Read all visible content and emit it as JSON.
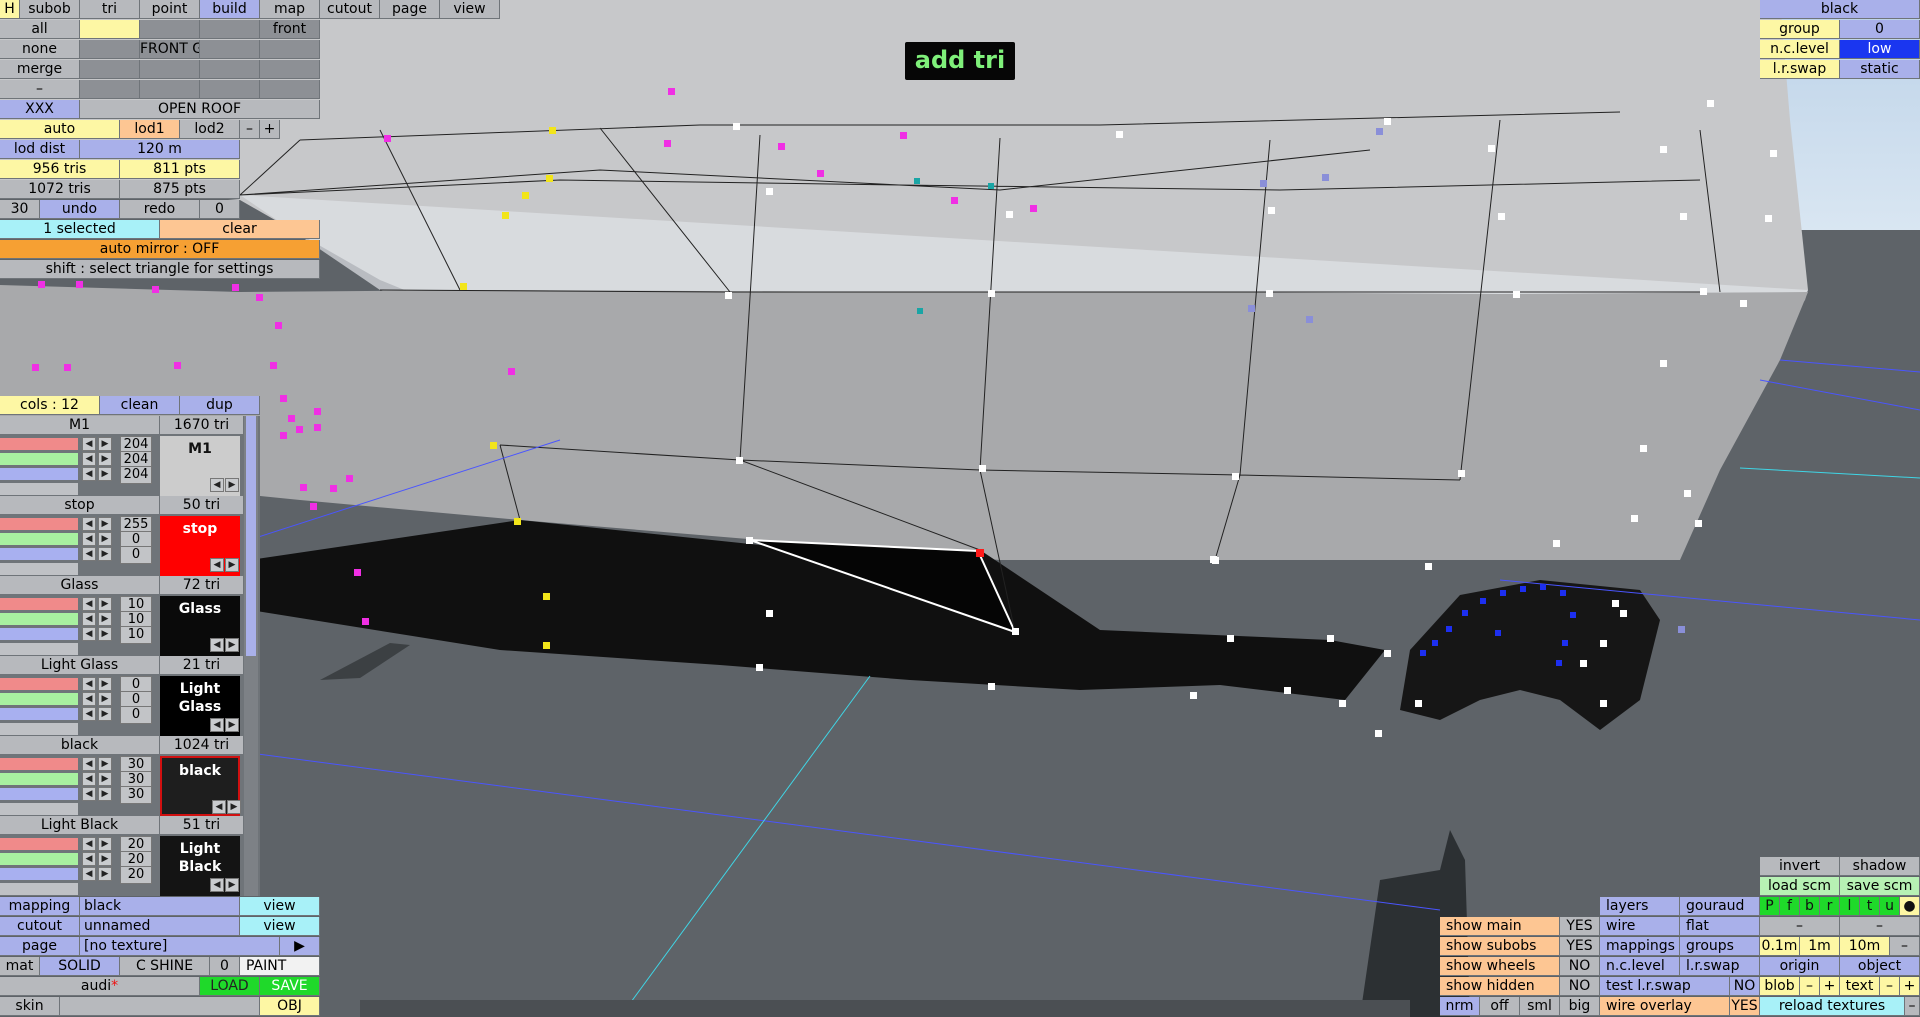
{
  "toast": "add tri",
  "top_tabs": {
    "h": "H",
    "subob": "subob",
    "tri": "tri",
    "point": "point",
    "build": "build",
    "map": "map",
    "cutout": "cutout",
    "page": "page",
    "view": "view"
  },
  "left_panel": {
    "all": "all",
    "front": "front",
    "none": "none",
    "front_g": "FRONT G",
    "merge": "merge",
    "dash": "–",
    "xxx": "XXX",
    "open_roof": "OPEN ROOF",
    "auto": "auto",
    "lod1": "lod1",
    "lod2": "lod2",
    "minus": "–",
    "plus": "+",
    "lod_dist_label": "lod dist",
    "lod_dist_value": "120 m",
    "tris1": "956 tris",
    "pts1": "811 pts",
    "tris2": "1072 tris",
    "pts2": "875 pts",
    "undo_count": "30",
    "undo": "undo",
    "redo": "redo",
    "redo_count": "0",
    "selected": "1 selected",
    "clear": "clear",
    "auto_mirror": "auto mirror : OFF",
    "hint": "shift : select triangle for settings"
  },
  "colours_panel": {
    "cols": "cols : 12",
    "clean": "clean",
    "dup": "dup",
    "materials": [
      {
        "name": "M1",
        "tris": "1670 tri",
        "r": "204",
        "g": "204",
        "b": "204",
        "swatch": "M1",
        "color": "#cccccc",
        "text": "#111111"
      },
      {
        "name": "stop",
        "tris": "50 tri",
        "r": "255",
        "g": "0",
        "b": "0",
        "swatch": "stop",
        "color": "#ff0000",
        "text": "#ffffff"
      },
      {
        "name": "Glass",
        "tris": "72 tri",
        "r": "10",
        "g": "10",
        "b": "10",
        "swatch": "Glass",
        "color": "#0a0a0a",
        "text": "#ffffff"
      },
      {
        "name": "Light Glass",
        "tris": "21 tri",
        "r": "0",
        "g": "0",
        "b": "0",
        "swatch": "Light Glass",
        "color": "#000000",
        "text": "#ffffff"
      },
      {
        "name": "black",
        "tris": "1024 tri",
        "r": "30",
        "g": "30",
        "b": "30",
        "swatch": "black",
        "color": "#1e1e1e",
        "text": "#ffffff"
      },
      {
        "name": "Light Black",
        "tris": "51 tri",
        "r": "20",
        "g": "20",
        "b": "20",
        "swatch": "Light Black",
        "color": "#141414",
        "text": "#ffffff"
      }
    ]
  },
  "bottom_left": {
    "mapping": "mapping",
    "mapping_val": "black",
    "view1": "view",
    "cutout": "cutout",
    "cutout_val": "unnamed",
    "view2": "view",
    "page": "page",
    "page_val": "[no texture]",
    "page_arrow": "▶",
    "mat": "mat",
    "solid": "SOLID",
    "cshine": "C SHINE",
    "zero": "0",
    "paint": "PAINT",
    "file": "audi",
    "asterisk": "*",
    "load": "LOAD",
    "save": "SAVE",
    "skin": "skin",
    "obj": "OBJ"
  },
  "top_right": {
    "black": "black",
    "group": "group",
    "group_val": "0",
    "nclevel": "n.c.level",
    "nclevel_val": "low",
    "lrswap": "l.r.swap",
    "lrswap_val": "static"
  },
  "bottom_right": {
    "invert": "invert",
    "shadow": "shadow",
    "load_scm": "load scm",
    "save_scm": "save scm",
    "letters": [
      "P",
      "f",
      "b",
      "r",
      "l",
      "t",
      "u",
      "●"
    ],
    "dash": "–",
    "m01": "0.1m",
    "m1": "1m",
    "m10": "10m",
    "origin": "origin",
    "object": "object",
    "blob": "blob",
    "minus": "–",
    "plus": "+",
    "text": "text",
    "reload": "reload textures",
    "layers": "layers",
    "gouraud": "gouraud",
    "wire": "wire",
    "flat": "flat",
    "mappings": "mappings",
    "groups": "groups",
    "nclevel": "n.c.level",
    "lrswap": "l.r.swap",
    "test_lrswap": "test l.r.swap",
    "test_no": "NO",
    "wire_overlay": "wire overlay",
    "wire_yes": "YES",
    "show_main": "show main",
    "show_main_v": "YES",
    "show_subobs": "show subobs",
    "show_subobs_v": "YES",
    "show_wheels": "show wheels",
    "show_wheels_v": "NO",
    "show_hidden": "show hidden",
    "show_hidden_v": "NO",
    "nrm": "nrm",
    "off": "off",
    "sml": "sml",
    "big": "big"
  }
}
